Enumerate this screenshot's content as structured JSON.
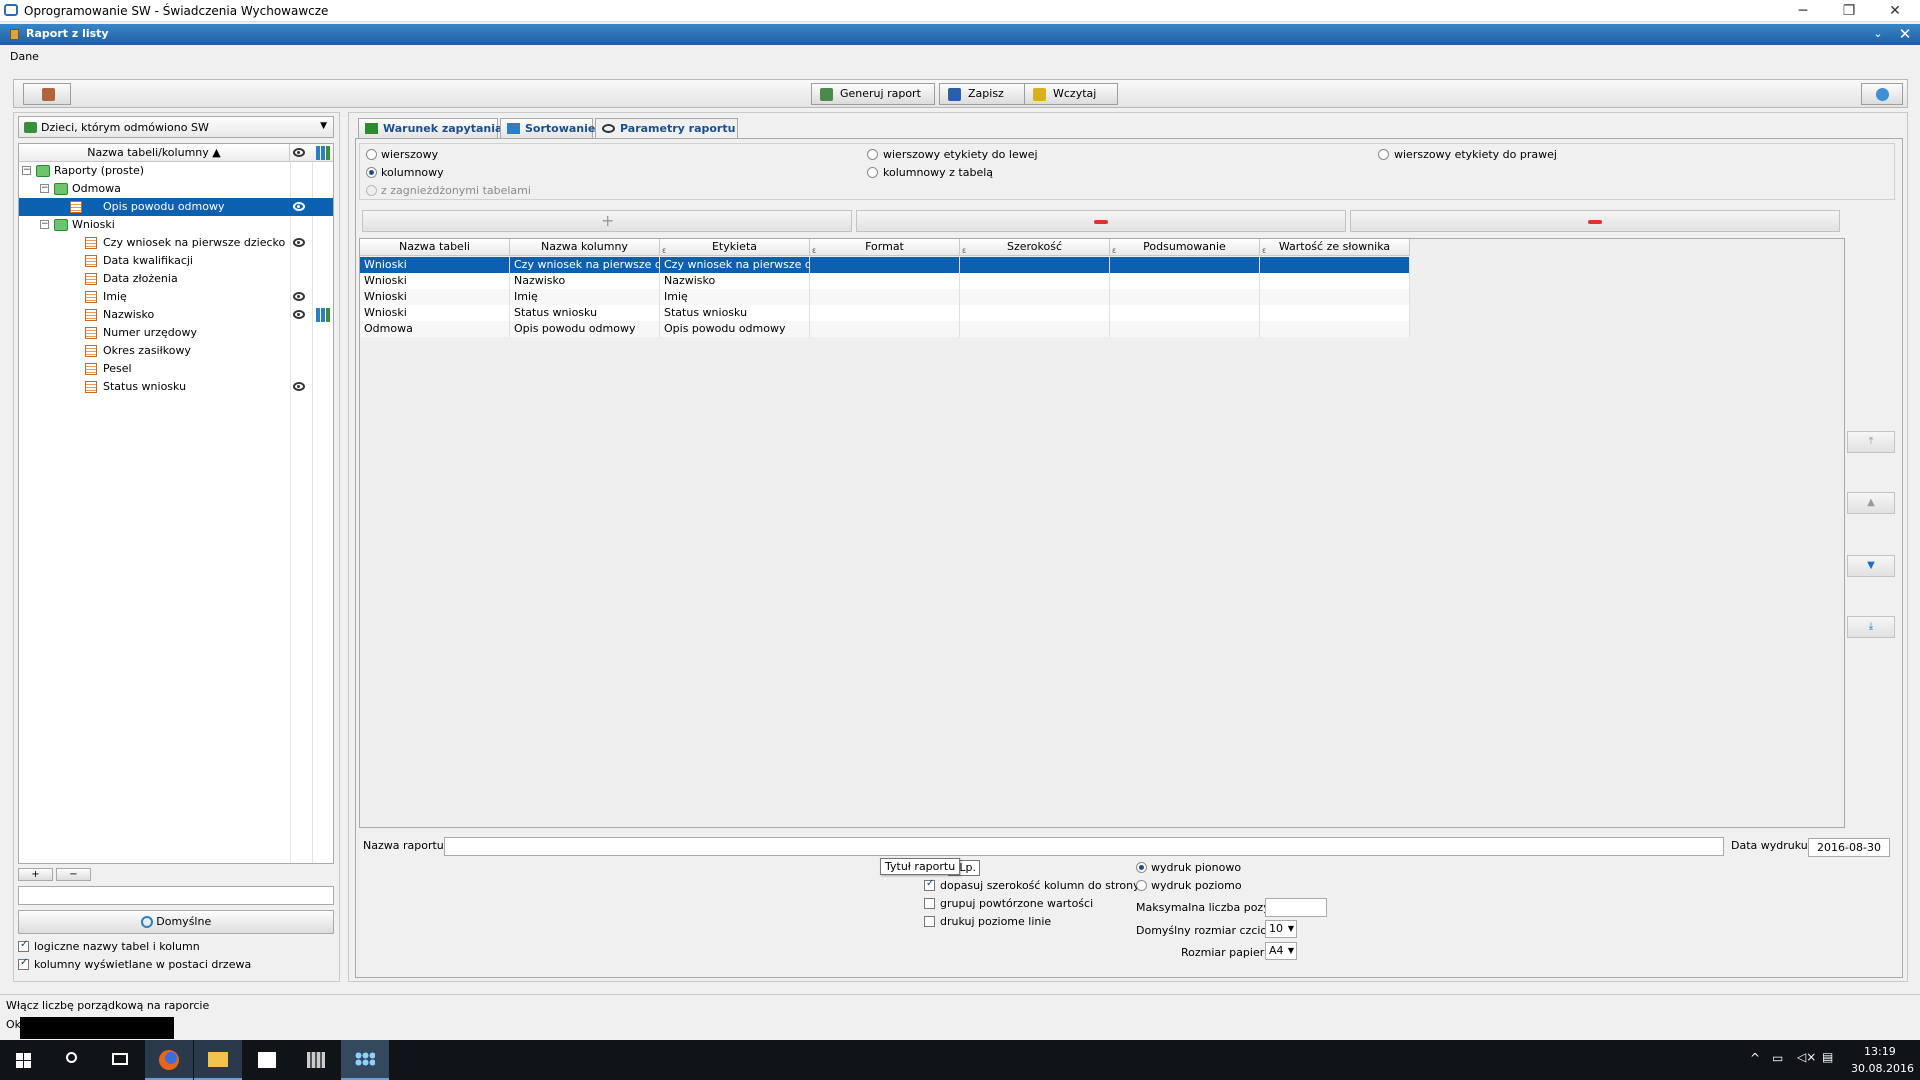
{
  "window": {
    "title": "Oprogramowanie SW - Świadczenia Wychowawcze",
    "subtitle": "Raport z listy"
  },
  "menu": {
    "dane": "Dane"
  },
  "toolbar": {
    "generuj": "Generuj raport",
    "zapisz": "Zapisz",
    "wczytaj": "Wczytaj"
  },
  "left": {
    "view_select": "Dzieci, którym odmówiono SW",
    "tree_header": "Nazwa tabeli/kolumny",
    "tree": [
      {
        "label": "Raporty (proste)"
      },
      {
        "label": "Odmowa"
      },
      {
        "label": "Opis powodu odmowy"
      },
      {
        "label": "Wnioski"
      },
      {
        "label": "Czy wniosek na pierwsze dziecko"
      },
      {
        "label": "Data kwalifikacji"
      },
      {
        "label": "Data złożenia"
      },
      {
        "label": "Imię"
      },
      {
        "label": "Nazwisko"
      },
      {
        "label": "Numer urzędowy"
      },
      {
        "label": "Okres zasiłkowy"
      },
      {
        "label": "Pesel"
      },
      {
        "label": "Status wniosku"
      }
    ],
    "add": "+",
    "remove": "−",
    "domyslne": "Domyślne",
    "chk1": "logiczne nazwy tabel i kolumn",
    "chk2": "kolumny wyświetlane w postaci drzewa"
  },
  "tabs": {
    "warunek": "Warunek zapytania",
    "sortowanie": "Sortowanie",
    "parametry": "Parametry raportu"
  },
  "options": {
    "wierszowy": "wierszowy",
    "wierszowy_lewej": "wierszowy etykiety do lewej",
    "wierszowy_prawej": "wierszowy etykiety do prawej",
    "kolumnowy": "kolumnowy",
    "kolumnowy_tabela": "kolumnowy z tabelą",
    "zagniezdzone": "z zagnieżdżonymi tabelami"
  },
  "grid": {
    "headers": [
      "Nazwa tabeli",
      "Nazwa kolumny",
      "Etykieta",
      "Format",
      "Szerokość",
      "Podsumowanie",
      "Wartość ze słownika"
    ],
    "rows": [
      [
        "Wnioski",
        "Czy wniosek na pierwsze d...",
        "Czy wniosek na pierwsze d..."
      ],
      [
        "Wnioski",
        "Nazwisko",
        "Nazwisko"
      ],
      [
        "Wnioski",
        "Imię",
        "Imię"
      ],
      [
        "Wnioski",
        "Status wniosku",
        "Status wniosku"
      ],
      [
        "Odmowa",
        "Opis powodu odmowy",
        "Opis powodu odmowy"
      ]
    ]
  },
  "bottom": {
    "nazwa_label": "Nazwa raportu:",
    "data_label": "Data wydruku:",
    "data_value": "2016-08-30",
    "tooltip": "Tytuł raportu",
    "lp_suffix": "e Lp.",
    "chk_dopasuj": "dopasuj szerokość kolumn do strony",
    "chk_grupuj": "grupuj powtórzone wartości",
    "chk_linie": "drukuj poziome linie",
    "r_pionowo": "wydruk pionowo",
    "r_poziomo": "wydruk poziomo",
    "max_label": "Maksymalna liczba pozycji:",
    "font_label": "Domyślny rozmiar czcionki:",
    "font_value": "10",
    "paper_label": "Rozmiar papieru:",
    "paper_value": "A4"
  },
  "status": {
    "text": "Włącz liczbę porządkową na raporcie",
    "text2": "Ok"
  },
  "taskbar": {
    "time": "13:19",
    "date": "30.08.2016"
  }
}
